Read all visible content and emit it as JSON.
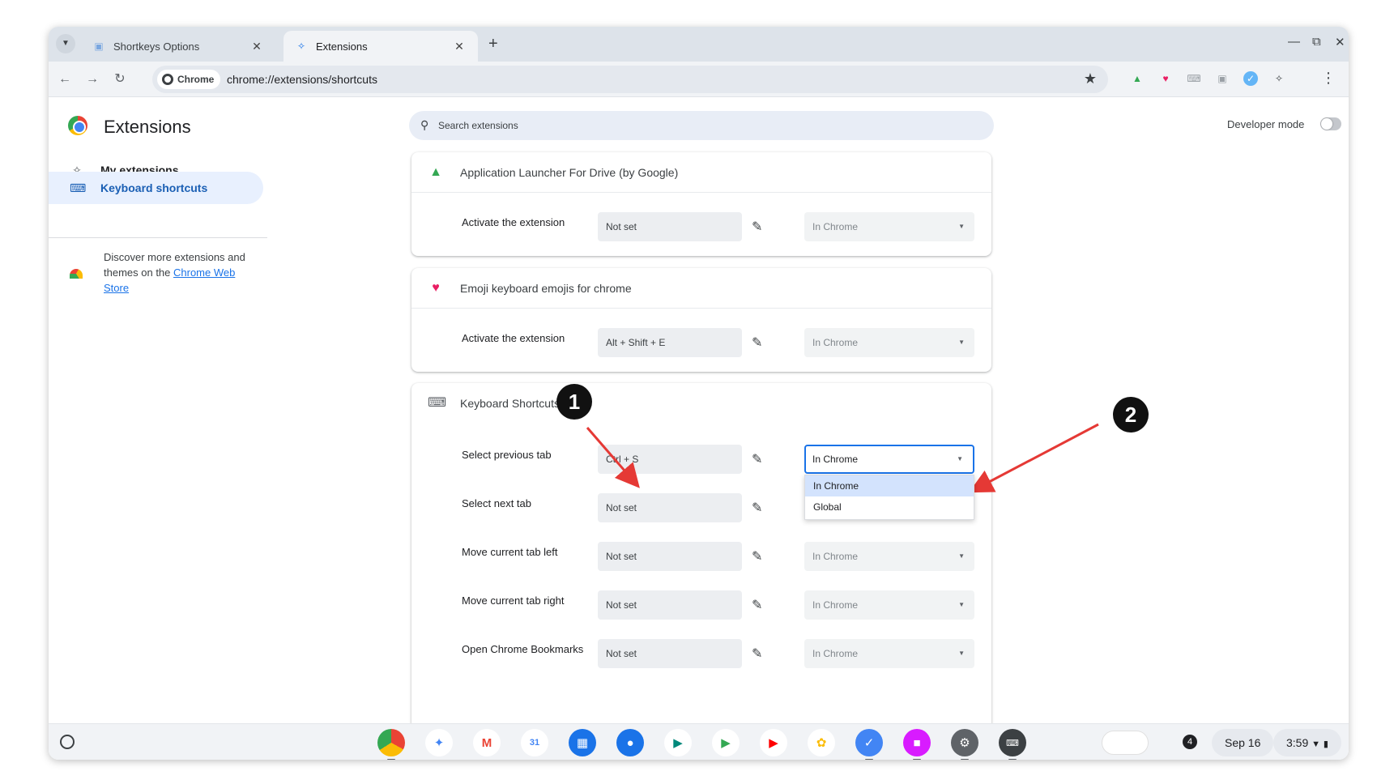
{
  "tabs": [
    {
      "title": "Shortkeys Options",
      "active": false
    },
    {
      "title": "Extensions",
      "active": true
    }
  ],
  "toolbar": {
    "chip_label": "Chrome",
    "url": "chrome://extensions/shortcuts"
  },
  "header": {
    "title": "Extensions",
    "search_placeholder": "Search extensions",
    "developer_mode_label": "Developer mode",
    "developer_mode_on": false
  },
  "sidebar": {
    "items": [
      {
        "label": "My extensions",
        "icon": "puzzle-icon",
        "active": false
      },
      {
        "label": "Keyboard shortcuts",
        "icon": "keyboard-icon",
        "active": true
      }
    ],
    "discover_text": "Discover more extensions and themes on the ",
    "webstore_link": "Chrome Web Store"
  },
  "cards": [
    {
      "name": "Application Launcher For Drive (by Google)",
      "icon": "google-drive-icon",
      "commands": [
        {
          "label": "Activate the extension",
          "shortcut": "Not set",
          "scope": "In Chrome"
        }
      ]
    },
    {
      "name": "Emoji keyboard emojis for chrome",
      "icon": "heart-emoji-icon",
      "commands": [
        {
          "label": "Activate the extension",
          "shortcut": "Alt + Shift + E",
          "scope": "In Chrome"
        }
      ]
    },
    {
      "name": "Keyboard Shortcuts",
      "icon": "keyboard-icon",
      "commands": [
        {
          "label": "Select previous tab",
          "shortcut": "Ctrl + S",
          "scope": "In Chrome",
          "dropdown_open": true
        },
        {
          "label": "Select next tab",
          "shortcut": "Not set",
          "scope": "In Chrome"
        },
        {
          "label": "Move current tab left",
          "shortcut": "Not set",
          "scope": "In Chrome"
        },
        {
          "label": "Move current tab right",
          "shortcut": "Not set",
          "scope": "In Chrome"
        },
        {
          "label": "Open Chrome Bookmarks",
          "shortcut": "Not set",
          "scope": "In Chrome"
        }
      ]
    }
  ],
  "scope_options": [
    "In Chrome",
    "Global"
  ],
  "annotations": [
    "1",
    "2"
  ],
  "shelf": {
    "notification_count": "4",
    "date": "Sep 16",
    "time": "3:59"
  }
}
